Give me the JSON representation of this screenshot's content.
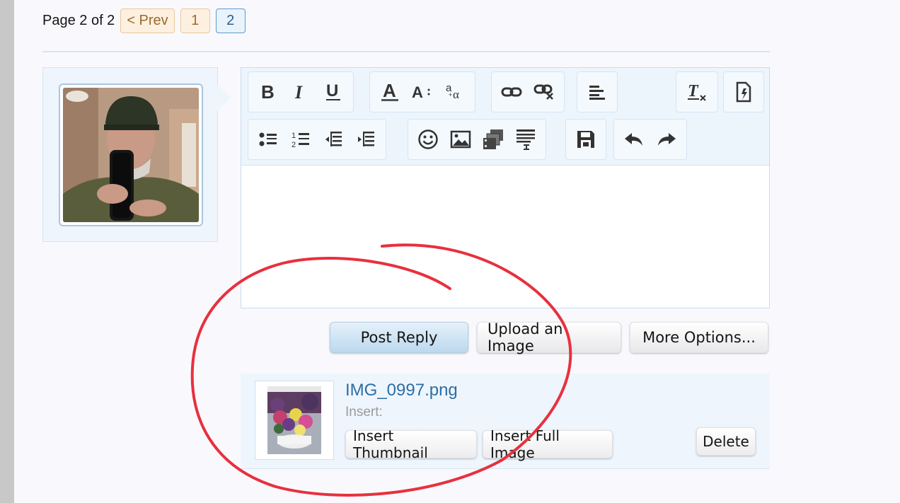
{
  "pagination": {
    "label": "Page 2 of 2",
    "prev": "< Prev",
    "pages": [
      "1",
      "2"
    ],
    "current": "2"
  },
  "toolbar": {
    "row1": [
      [
        "bold-icon",
        "italic-icon",
        "underline-icon"
      ],
      [
        "text-color-icon",
        "font-size-icon",
        "font-family-icon"
      ],
      [
        "link-icon",
        "unlink-icon"
      ],
      [
        "align-icon"
      ],
      [
        "remove-format-icon",
        "bbcode-toggle-icon"
      ]
    ],
    "row2": [
      [
        "bullet-list-icon",
        "numbered-list-icon",
        "outdent-icon",
        "indent-icon"
      ],
      [
        "smilie-icon",
        "image-icon",
        "media-icon",
        "quote-icon"
      ],
      [
        "save-draft-icon"
      ],
      [
        "undo-icon",
        "redo-icon"
      ]
    ]
  },
  "editor": {
    "content": ""
  },
  "actions": {
    "post_reply": "Post Reply",
    "upload_image": "Upload an Image",
    "more_options": "More Options..."
  },
  "attachment": {
    "filename": "IMG_0997.png",
    "insert_label": "Insert:",
    "insert_thumbnail": "Insert Thumbnail",
    "insert_full": "Insert Full Image",
    "delete": "Delete"
  },
  "colors": {
    "link": "#2d6ea4",
    "annotation": "#e8303e",
    "panel_bg": "#eef5fd"
  }
}
